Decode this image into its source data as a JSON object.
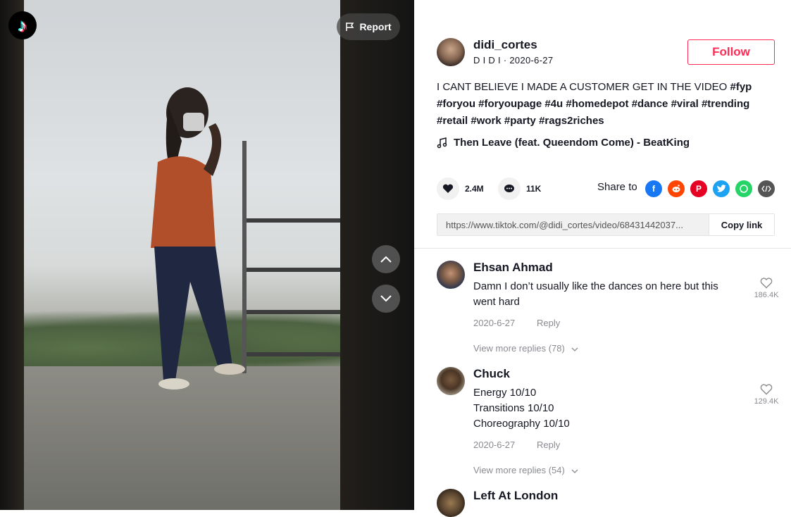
{
  "logo": {
    "glyph": "♪"
  },
  "report": {
    "label": "Report"
  },
  "author": {
    "username": "didi_cortes",
    "nickname": "D I D I",
    "date": "2020-6-27"
  },
  "follow": {
    "label": "Follow"
  },
  "caption": {
    "text": "I CANT BELIEVE I MADE A CUSTOMER GET IN THE VIDEO",
    "hashtags": "#fyp #foryou #foryoupage #4u #homedepot #dance #viral #trending #retail #work #party #rags2riches"
  },
  "music": {
    "title": "Then Leave (feat. Queendom Come) - BeatKing"
  },
  "stats": {
    "likes": "2.4M",
    "comments": "11K"
  },
  "share": {
    "label": "Share to",
    "targets": [
      "facebook-icon",
      "reddit-icon",
      "pinterest-icon",
      "twitter-icon",
      "whatsapp-icon",
      "embed-icon"
    ]
  },
  "link": {
    "url": "https://www.tiktok.com/@didi_cortes/video/68431442037...",
    "copy_label": "Copy link"
  },
  "comments": [
    {
      "name": "Ehsan Ahmad",
      "text": "Damn I don’t usually like the dances on here but this went hard",
      "date": "2020-6-27",
      "reply_label": "Reply",
      "likes": "186.4K",
      "more": "View more replies (78)"
    },
    {
      "name": "Chuck",
      "lines": [
        "Energy 10/10",
        "Transitions 10/10",
        "Choreography 10/10"
      ],
      "date": "2020-6-27",
      "reply_label": "Reply",
      "likes": "129.4K",
      "more": "View more replies (54)"
    },
    {
      "name": "Left At London"
    }
  ],
  "colors": {
    "accent": "#fe2c55",
    "text": "#161823",
    "muted": "#8a8b91"
  }
}
